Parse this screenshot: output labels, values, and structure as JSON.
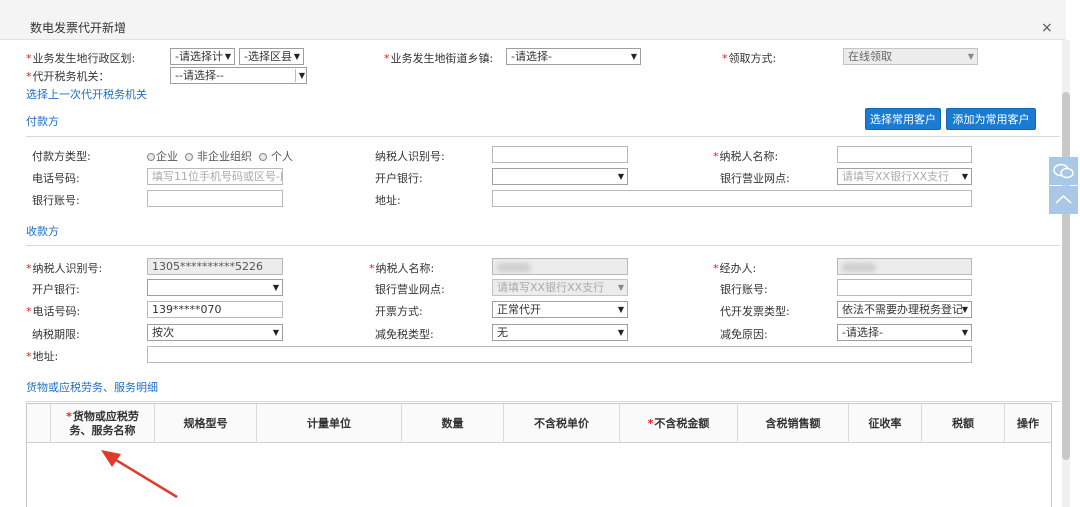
{
  "dialog": {
    "title": "数电发票代开新增",
    "close_glyph": "×"
  },
  "top": {
    "admin_region_label": "业务发生地行政区划:",
    "admin_region_sel1": "-请选择计",
    "admin_region_sel2": "-选择区县",
    "street_label": "业务发生地街道乡镇:",
    "street_sel": "-请选择-",
    "receive_label": "领取方式:",
    "receive_sel": "在线领取",
    "tax_office_label": "代开税务机关：",
    "tax_office_sel": "--请选择--",
    "last_office_link": "选择上一次代开税务机关"
  },
  "payer": {
    "section": "付款方",
    "btn_choose": "选择常用客户",
    "btn_add": "添加为常用客户",
    "type_label": "付款方类型:",
    "type_opts": [
      "企业",
      "非企业组织",
      "个人"
    ],
    "taxid_label": "纳税人识别号:",
    "taxid_value": "",
    "name_label": "纳税人名称:",
    "name_value": "",
    "phone_label": "电话号码:",
    "phone_placeholder": "填写11位手机号码或区号-座",
    "bank_label": "开户银行:",
    "bank_value": "",
    "branch_label": "银行营业网点:",
    "branch_value": "请填写XX银行XX支行",
    "account_label": "银行账号:",
    "account_value": "",
    "address_label": "地址:",
    "address_value": ""
  },
  "payee": {
    "section": "收款方",
    "taxid_label": "纳税人识别号:",
    "taxid_value": "1305**********5226",
    "name_label": "纳税人名称:",
    "handler_label": "经办人:",
    "bank_label": "开户银行:",
    "bank_value": "",
    "branch_label": "银行营业网点:",
    "branch_value": "请填写XX银行XX支行",
    "account_label": "银行账号:",
    "account_value": "",
    "phone_label": "电话号码:",
    "phone_value": "139*****070",
    "invoice_method_label": "开票方式:",
    "invoice_method_value": "正常代开",
    "invoice_type_label": "代开发票类型:",
    "invoice_type_value": "依法不需要办理税务登记",
    "tax_period_label": "纳税期限:",
    "tax_period_value": "按次",
    "exempt_type_label": "减免税类型:",
    "exempt_type_value": "无",
    "exempt_reason_label": "减免原因:",
    "exempt_reason_value": "-请选择-",
    "address_label": "地址:",
    "address_value": ""
  },
  "goods": {
    "section": "货物或应税劳务、服务明细",
    "columns": [
      "货物或应税劳务、服务名称",
      "规格型号",
      "计量单位",
      "数量",
      "不含税单价",
      "不含税金额",
      "含税销售额",
      "征收率",
      "税额",
      "操作"
    ],
    "col_name_line1": "货物或应税劳",
    "col_name_line2": "务、服务名称"
  },
  "accent": "#1a7bd1",
  "required_color": "#e02020",
  "annotation_color": "#e23a2a"
}
